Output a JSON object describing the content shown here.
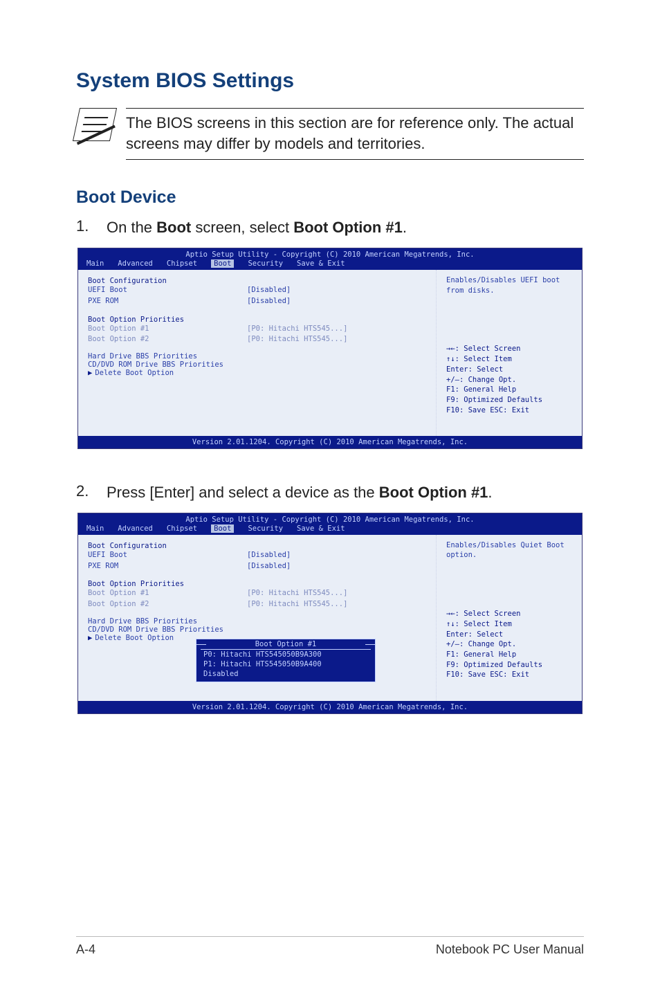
{
  "page": {
    "title": "System BIOS Settings",
    "note": "The BIOS screens in this section are for reference only. The actual screens may differ by models and territories.",
    "subTitle": "Boot Device"
  },
  "step1": {
    "num": "1.",
    "prefix": "On the ",
    "bold1": "Boot",
    "mid": " screen, select ",
    "bold2": "Boot Option #1",
    "suffix": "."
  },
  "step2": {
    "num": "2.",
    "prefix": "Press [Enter] and select a device as the ",
    "bold1": "Boot Option #1",
    "suffix": "."
  },
  "bios1": {
    "title": "Aptio Setup Utility - Copyright (C) 2010 American Megatrends, Inc.",
    "tabs": {
      "main": "Main",
      "advanced": "Advanced",
      "chipset": "Chipset",
      "boot": "Boot",
      "security": "Security",
      "saveexit": "Save & Exit"
    },
    "left": {
      "bootConfig": "Boot Configuration",
      "uefiBoot_k": "UEFI Boot",
      "uefiBoot_v": "[Disabled]",
      "pxeRom_k": "PXE ROM",
      "pxeRom_v": "[Disabled]",
      "priorities": "Boot Option Priorities",
      "opt1_k": "Boot Option #1",
      "opt1_v": "[P0: Hitachi HTS545...]",
      "opt2_k": "Boot Option #2",
      "opt2_v": "[P0: Hitachi HTS545...]",
      "hdd": "Hard Drive BBS Priorities",
      "cd": "CD/DVD ROM Drive BBS Priorities",
      "del": "Delete Boot Option"
    },
    "right": {
      "help": "Enables/Disables UEFI boot from disks.",
      "k_screen": "→←: Select Screen",
      "k_item": "↑↓:  Select Item",
      "k_enter": "Enter: Select",
      "k_chg": "+/—:  Change Opt.",
      "k_f1": "F1:   General Help",
      "k_f9": "F9:   Optimized Defaults",
      "k_f10": "F10:  Save   ESC: Exit"
    },
    "footer": "Version 2.01.1204. Copyright (C) 2010 American Megatrends, Inc."
  },
  "bios2": {
    "title": "Aptio Setup Utility - Copyright (C) 2010 American Megatrends, Inc.",
    "tabs": {
      "main": "Main",
      "advanced": "Advanced",
      "chipset": "Chipset",
      "boot": "Boot",
      "security": "Security",
      "saveexit": "Save & Exit"
    },
    "left": {
      "bootConfig": "Boot Configuration",
      "uefiBoot_k": "UEFI Boot",
      "uefiBoot_v": "[Disabled]",
      "pxeRom_k": "PXE ROM",
      "pxeRom_v": "[Disabled]",
      "priorities": "Boot Option Priorities",
      "opt1_k": "Boot Option #1",
      "opt1_v": "[P0: Hitachi HTS545...]",
      "opt2_k": "Boot Option #2",
      "opt2_v": "[P0: Hitachi HTS545...]",
      "hdd": "Hard Drive BBS Priorities",
      "cd": "CD/DVD ROM Drive BBS Priorities",
      "del": "Delete Boot Option"
    },
    "popup": {
      "title": "Boot Option #1",
      "opt1": "P0: Hitachi HTS545050B9A300",
      "opt2": "P1: Hitachi HTS545050B9A400",
      "opt3": "Disabled"
    },
    "right": {
      "help": "Enables/Disables Quiet Boot option.",
      "k_screen": "→←: Select Screen",
      "k_item": "↑↓:  Select Item",
      "k_enter": "Enter: Select",
      "k_chg": "+/—:  Change Opt.",
      "k_f1": "F1:   General Help",
      "k_f9": "F9:   Optimized Defaults",
      "k_f10": "F10:  Save   ESC: Exit"
    },
    "footer": "Version 2.01.1204. Copyright (C) 2010 American Megatrends, Inc."
  },
  "footer": {
    "left": "A-4",
    "right": "Notebook PC User Manual"
  }
}
